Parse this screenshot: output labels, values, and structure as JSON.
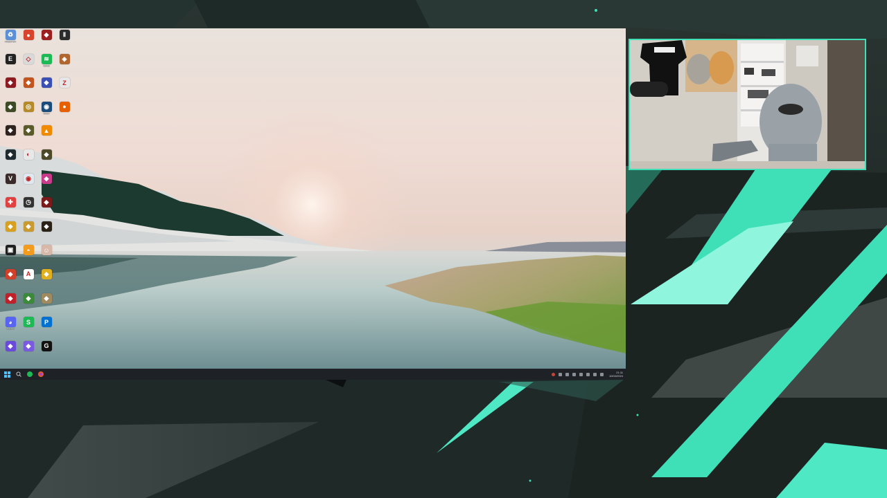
{
  "desktop": {
    "icons": [
      {
        "label": "Recycle Bin",
        "icon": "recycle-bin-icon",
        "color": "#5b8fd6",
        "glyph": "♻"
      },
      {
        "label": "",
        "icon": "app-red-circle-icon",
        "color": "#d8432d",
        "glyph": "●"
      },
      {
        "label": "",
        "icon": "game-red-icon",
        "color": "#9c1f1f",
        "glyph": "◆"
      },
      {
        "label": "",
        "icon": "game-dark-icon",
        "color": "#2b2b2b",
        "glyph": "Ⅱ"
      },
      {
        "label": "",
        "icon": "epic-games-icon",
        "color": "#222222",
        "glyph": "E"
      },
      {
        "label": "",
        "icon": "app-white-icon",
        "color": "#d9d9d9",
        "glyph": "◇"
      },
      {
        "label": "Spotify",
        "icon": "spotify-icon",
        "color": "#1db954",
        "glyph": "≋"
      },
      {
        "label": "",
        "icon": "game-orange-icon",
        "color": "#b0662e",
        "glyph": "◈"
      },
      {
        "label": "",
        "icon": "game-red2-icon",
        "color": "#8d1b22",
        "glyph": "◆"
      },
      {
        "label": "",
        "icon": "game-orange2-icon",
        "color": "#c0551f",
        "glyph": "◆"
      },
      {
        "label": "",
        "icon": "game-blue-icon",
        "color": "#3c4fb2",
        "glyph": "◆"
      },
      {
        "label": "",
        "icon": "z-app-icon",
        "color": "#e6e6e6",
        "glyph": "Z"
      },
      {
        "label": "",
        "icon": "game-green-icon",
        "color": "#3d4a26",
        "glyph": "◆"
      },
      {
        "label": "",
        "icon": "game-gold-icon",
        "color": "#b58a2a",
        "glyph": "◎"
      },
      {
        "label": "Steam",
        "icon": "steam-icon",
        "color": "#1b4c7a",
        "glyph": "◉"
      },
      {
        "label": "",
        "icon": "firefox-icon",
        "color": "#e66000",
        "glyph": "●"
      },
      {
        "label": "",
        "icon": "game-dark2-icon",
        "color": "#30221e",
        "glyph": "◆"
      },
      {
        "label": "",
        "icon": "game-olive-icon",
        "color": "#5a5a2a",
        "glyph": "◆"
      },
      {
        "label": "",
        "icon": "vlc-icon",
        "color": "#f08a00",
        "glyph": "▲"
      },
      {
        "label": "",
        "icon": "blank-slot",
        "color": "",
        "glyph": ""
      },
      {
        "label": "",
        "icon": "game-dark3-icon",
        "color": "#1e2a30",
        "glyph": "◆"
      },
      {
        "label": "",
        "icon": "app-white2-icon",
        "color": "#e8e8e8",
        "glyph": "◐"
      },
      {
        "label": "",
        "icon": "game-olive2-icon",
        "color": "#4d4a2a",
        "glyph": "◆"
      },
      {
        "label": "",
        "icon": "blank-slot",
        "color": "",
        "glyph": ""
      },
      {
        "label": "",
        "icon": "game-v-icon",
        "color": "#3a2a2a",
        "glyph": "V"
      },
      {
        "label": "",
        "icon": "eye-app-icon",
        "color": "#dfe8ee",
        "glyph": "◉"
      },
      {
        "label": "",
        "icon": "game-pink-icon",
        "color": "#c83a8a",
        "glyph": "◆"
      },
      {
        "label": "",
        "icon": "blank-slot",
        "color": "",
        "glyph": ""
      },
      {
        "label": "",
        "icon": "app-red-white-icon",
        "color": "#e04040",
        "glyph": "✚"
      },
      {
        "label": "",
        "icon": "clock-app-icon",
        "color": "#333333",
        "glyph": "◷"
      },
      {
        "label": "",
        "icon": "game-red3-icon",
        "color": "#7a1a1a",
        "glyph": "◆"
      },
      {
        "label": "",
        "icon": "blank-slot",
        "color": "",
        "glyph": ""
      },
      {
        "label": "",
        "icon": "game-yellow-icon",
        "color": "#d8a020",
        "glyph": "◆"
      },
      {
        "label": "",
        "icon": "game-yellow2-icon",
        "color": "#c89a30",
        "glyph": "◆"
      },
      {
        "label": "",
        "icon": "game-black-gold-icon",
        "color": "#2a2216",
        "glyph": "◆"
      },
      {
        "label": "",
        "icon": "blank-slot",
        "color": "",
        "glyph": ""
      },
      {
        "label": "",
        "icon": "app-dark-box-icon",
        "color": "#202020",
        "glyph": "▣"
      },
      {
        "label": "",
        "icon": "overwatch-icon",
        "color": "#f29b1d",
        "glyph": "◓"
      },
      {
        "label": "",
        "icon": "face-app-icon",
        "color": "#d8b8a8",
        "glyph": "☺"
      },
      {
        "label": "",
        "icon": "blank-slot",
        "color": "",
        "glyph": ""
      },
      {
        "label": "",
        "icon": "game-red-yellow-icon",
        "color": "#d0402a",
        "glyph": "◆"
      },
      {
        "label": "",
        "icon": "game-a-icon",
        "color": "#ffffff",
        "glyph": "A"
      },
      {
        "label": "",
        "icon": "game-gold2-icon",
        "color": "#e0b020",
        "glyph": "◆"
      },
      {
        "label": "",
        "icon": "blank-slot",
        "color": "",
        "glyph": ""
      },
      {
        "label": "",
        "icon": "game-red4-icon",
        "color": "#c0202a",
        "glyph": "◆"
      },
      {
        "label": "",
        "icon": "game-green2-icon",
        "color": "#3a8a3a",
        "glyph": "◆"
      },
      {
        "label": "",
        "icon": "game-tan-icon",
        "color": "#a08a60",
        "glyph": "◆"
      },
      {
        "label": "",
        "icon": "blank-slot",
        "color": "",
        "glyph": ""
      },
      {
        "label": "Discord",
        "icon": "discord-icon",
        "color": "#5865f2",
        "glyph": "◕"
      },
      {
        "label": "",
        "icon": "s-app-icon",
        "color": "#1db954",
        "glyph": "S"
      },
      {
        "label": "",
        "icon": "playstation-icon",
        "color": "#0070d1",
        "glyph": "P"
      },
      {
        "label": "",
        "icon": "blank-slot",
        "color": "",
        "glyph": ""
      },
      {
        "label": "",
        "icon": "game-purple-icon",
        "color": "#6a4ad8",
        "glyph": "◆"
      },
      {
        "label": "",
        "icon": "app-purple-icon",
        "color": "#7a5ae0",
        "glyph": "◆"
      },
      {
        "label": "",
        "icon": "logitech-icon",
        "color": "#111111",
        "glyph": "G"
      }
    ]
  },
  "taskbar": {
    "left_icons": [
      "start-icon",
      "search-icon",
      "spotify-taskbar-icon",
      "firefox-taskbar-icon"
    ],
    "tray_icons": [
      "red-tray-icon",
      "tray-icon",
      "tray-icon",
      "tray-icon",
      "tray-icon",
      "tray-icon",
      "tray-icon",
      "tray-icon"
    ],
    "clock_time": "21:11",
    "clock_date": "10/04/2024"
  },
  "colors": {
    "accent": "#3fe0b8",
    "accent_light": "#6ef3d2",
    "background": "#1b2422"
  }
}
